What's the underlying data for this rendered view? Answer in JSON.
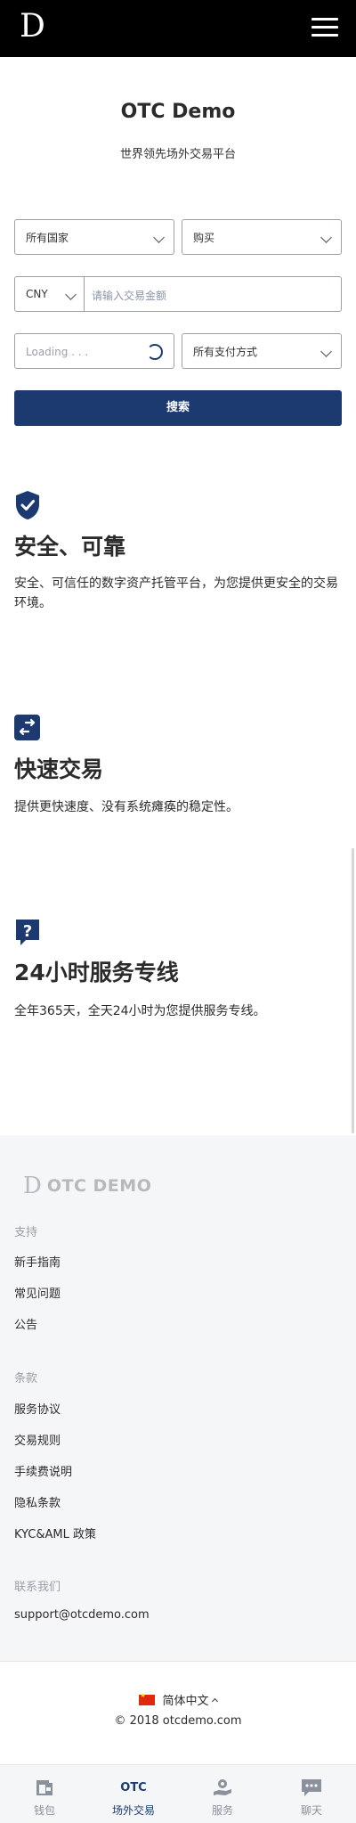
{
  "header": {
    "logo": "D",
    "menu_icon": "hamburger-menu-icon"
  },
  "hero": {
    "title": "OTC Demo",
    "subtitle": "世界领先场外交易平台"
  },
  "form": {
    "country_select": "所有国家",
    "trade_type_select": "购买",
    "currency_select": "CNY",
    "amount_placeholder": "请输入交易金额",
    "loading_text": "Loading . . .",
    "payment_select": "所有支付方式",
    "search_label": "搜索"
  },
  "features": [
    {
      "icon": "shield-check-icon",
      "title": "安全、可靠",
      "desc": "安全、可信任的数字资产托管平台，为您提供更安全的交易环境。"
    },
    {
      "icon": "exchange-icon",
      "title": "快速交易",
      "desc": "提供更快速度、没有系统瘫痪的稳定性。"
    },
    {
      "icon": "question-chat-icon",
      "title": "24小时服务专线",
      "desc": "全年365天，全天24小时为您提供服务专线。"
    }
  ],
  "footer": {
    "logo_d": "D",
    "logo_text": "OTC DEMO",
    "support": {
      "heading": "支持",
      "links": [
        "新手指南",
        "常见问题",
        "公告"
      ]
    },
    "terms": {
      "heading": "条款",
      "links": [
        "服务协议",
        "交易规则",
        "手续费说明",
        "隐私条款",
        "KYC&AML 政策"
      ]
    },
    "contact": {
      "heading": "联系我们",
      "email": "support@otcdemo.com"
    },
    "language": "简体中文",
    "copyright": "© 2018 otcdemo.com"
  },
  "bottom_nav": {
    "items": [
      {
        "label": "钱包",
        "icon": "wallet-icon"
      },
      {
        "label": "场外交易",
        "icon_text": "OTC",
        "active": true
      },
      {
        "label": "服务",
        "icon": "service-hand-icon"
      },
      {
        "label": "聊天",
        "icon": "chat-icon"
      }
    ]
  },
  "colors": {
    "primary": "#1c3a70",
    "topbar": "#000000",
    "footer_bg": "#f5f6f7",
    "muted": "#9aa0a8"
  }
}
